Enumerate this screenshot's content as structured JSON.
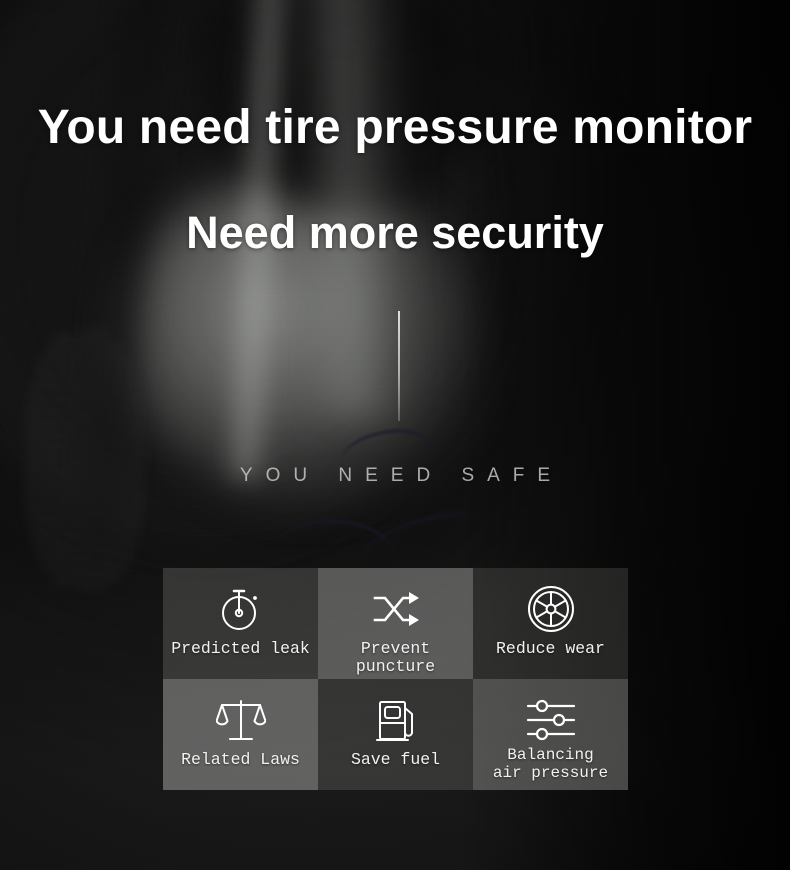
{
  "banner": {
    "headline_line1": "You need tire pressure monitor",
    "headline_line2": "Need more security",
    "tagline": "YOU NEED SAFE",
    "accent_color": "#ffffff",
    "text_color": "#f2f2f2",
    "tagline_color": "#cdcecc",
    "background_theme": "blurred-dark-tire-photo"
  },
  "features": {
    "columns": 3,
    "rows": 2,
    "items": [
      {
        "label": "Predicted leak",
        "icon": "stopwatch-icon",
        "multiline": false
      },
      {
        "label": "Prevent puncture",
        "icon": "shuffle-arrows-icon",
        "multiline": false
      },
      {
        "label": "Reduce wear",
        "icon": "wheel-icon",
        "multiline": false
      },
      {
        "label": "Related Laws",
        "icon": "balance-scales-icon",
        "multiline": false
      },
      {
        "label": "Save fuel",
        "icon": "fuel-pump-icon",
        "multiline": false
      },
      {
        "label": "Balancing\nair pressure",
        "icon": "sliders-icon",
        "multiline": true
      }
    ]
  }
}
